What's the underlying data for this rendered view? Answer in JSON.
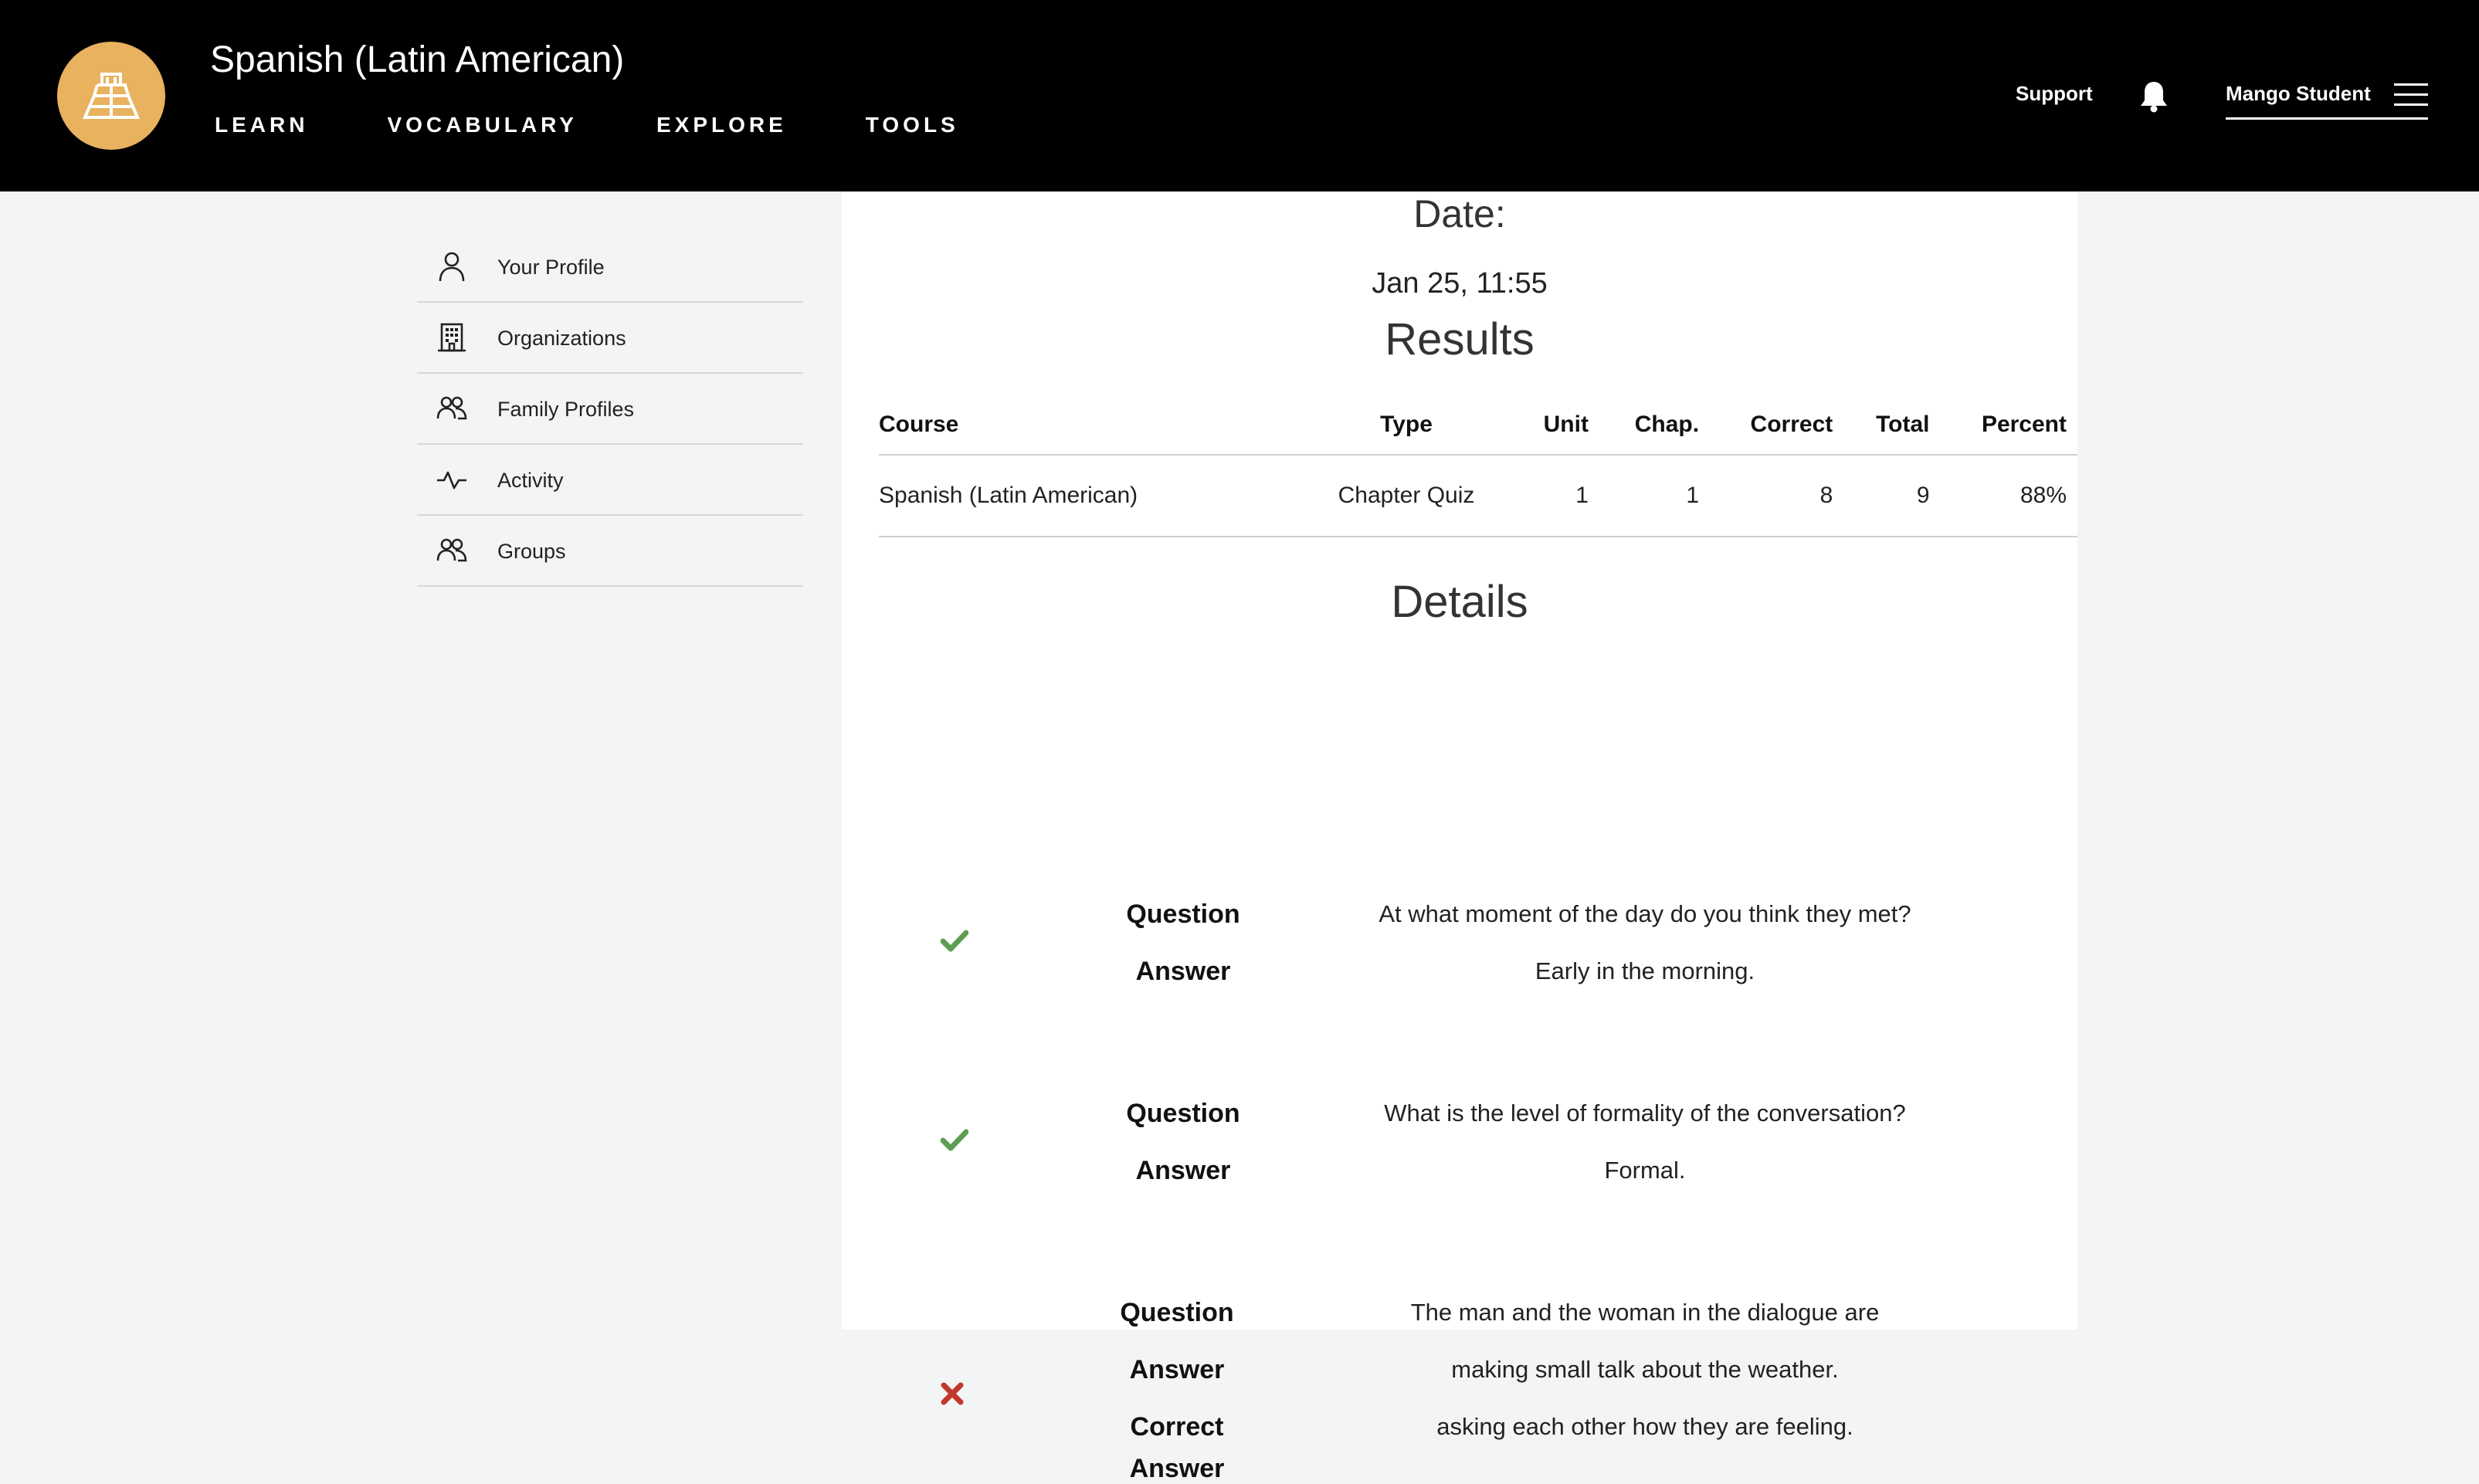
{
  "header": {
    "course_title": "Spanish (Latin American)",
    "nav": [
      "LEARN",
      "VOCABULARY",
      "EXPLORE",
      "TOOLS"
    ],
    "support_label": "Support",
    "user_name": "Mango Student",
    "logo_color": "#e8b25e"
  },
  "sidebar": {
    "items": [
      {
        "label": "Your Profile",
        "icon": "person-icon"
      },
      {
        "label": "Organizations",
        "icon": "building-icon"
      },
      {
        "label": "Family Profiles",
        "icon": "people-icon"
      },
      {
        "label": "Activity",
        "icon": "activity-icon"
      },
      {
        "label": "Groups",
        "icon": "people-icon"
      }
    ]
  },
  "main": {
    "date_label": "Date:",
    "date_value": "Jan 25, 11:55",
    "results_heading": "Results",
    "results_table": {
      "headers": [
        "Course",
        "Type",
        "Unit",
        "Chap.",
        "Correct",
        "Total",
        "Percent"
      ],
      "rows": [
        [
          "Spanish (Latin American)",
          "Chapter Quiz",
          "1",
          "1",
          "8",
          "9",
          "88%"
        ]
      ]
    },
    "details_heading": "Details",
    "labels": {
      "question": "Question",
      "answer": "Answer",
      "correct_answer_line1": "Correct",
      "correct_answer_line2": "Answer"
    },
    "details": [
      {
        "status": "correct",
        "question": "At what moment of the day do you think they met?",
        "answer": "Early in the morning."
      },
      {
        "status": "correct",
        "question": "What is the level of formality of the conversation?",
        "answer": "Formal."
      },
      {
        "status": "incorrect",
        "question": "The man and the woman in the dialogue are",
        "answer": "making small talk about the weather.",
        "correct_answer": "asking each other how they are feeling."
      }
    ],
    "colors": {
      "correct": "#5f9e52",
      "incorrect": "#c0392b"
    }
  }
}
